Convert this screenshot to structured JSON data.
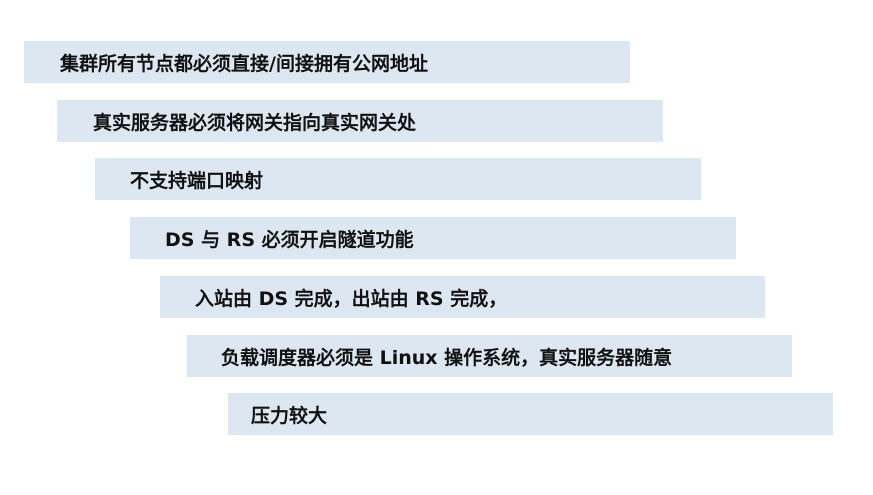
{
  "items": [
    {
      "label": "集群所有节点都必须直接/间接拥有公网地址"
    },
    {
      "label": "真实服务器必须将网关指向真实网关处"
    },
    {
      "label": "不支持端口映射"
    },
    {
      "label": "DS 与 RS 必须开启隧道功能"
    },
    {
      "label": "入站由 DS 完成，出站由 RS 完成，"
    },
    {
      "label": "负载调度器必须是 Linux 操作系统，真实服务器随意"
    },
    {
      "label": "压力较大"
    }
  ],
  "colors": {
    "bar_fill": "#dde7f2",
    "text": "#111111",
    "background": "#ffffff"
  }
}
